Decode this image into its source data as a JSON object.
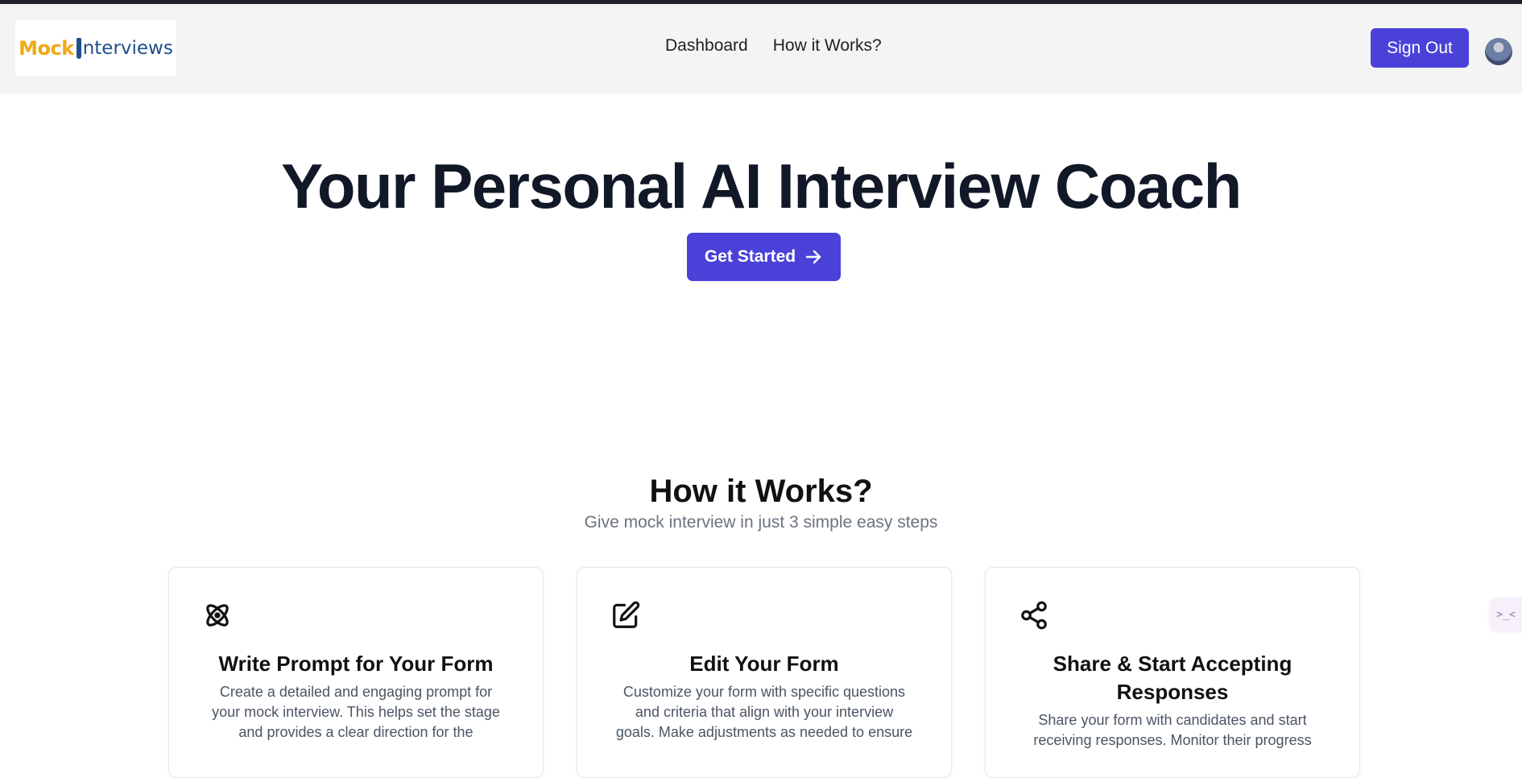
{
  "header": {
    "logo": {
      "part1": "Mock",
      "part2": "nterviews"
    },
    "nav": [
      {
        "label": "Dashboard"
      },
      {
        "label": "How it Works?"
      }
    ],
    "sign_out_label": "Sign Out"
  },
  "hero": {
    "title": "Your Personal AI Interview Coach",
    "cta_label": "Get Started"
  },
  "how_it_works": {
    "title": "How it Works?",
    "subtitle": "Give mock interview in just 3 simple easy steps",
    "cards": [
      {
        "icon": "atom-icon",
        "title": "Write Prompt for Your Form",
        "lines": [
          "Create a detailed and engaging prompt for",
          "your mock interview. This helps set the stage",
          "and provides a clear direction for the"
        ]
      },
      {
        "icon": "edit-icon",
        "title": "Edit Your Form",
        "lines": [
          "Customize your form with specific questions",
          "and criteria that align with your interview",
          "goals. Make adjustments as needed to ensure"
        ]
      },
      {
        "icon": "share-icon",
        "title_lines": [
          "Share & Start Accepting",
          "Responses"
        ],
        "lines": [
          "Share your form with candidates and start",
          "receiving responses. Monitor their progress"
        ]
      }
    ]
  },
  "side_widget": {
    "glyph": ">_<"
  },
  "colors": {
    "brand": "#4a42d8",
    "logo_yellow": "#f2a814",
    "logo_blue": "#1d4f8a",
    "heading": "#111827",
    "muted": "#6b7280"
  }
}
